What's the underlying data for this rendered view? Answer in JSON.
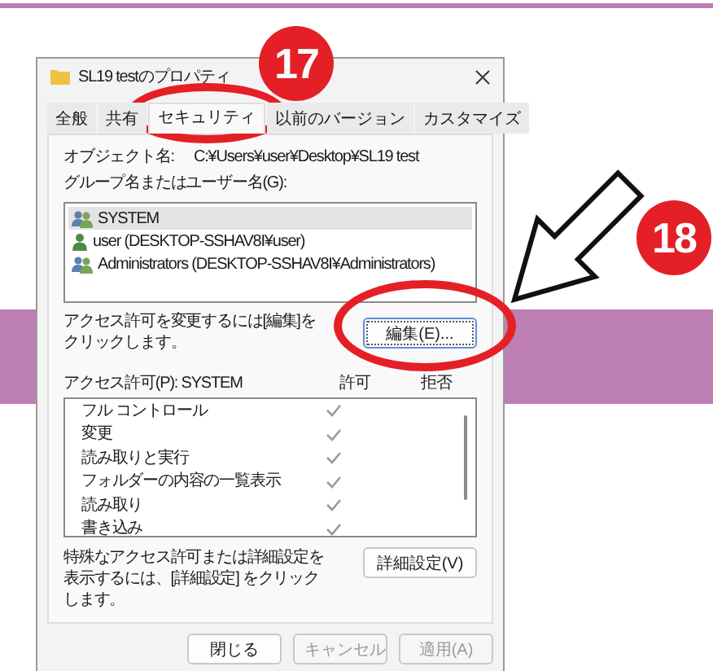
{
  "window": {
    "title": "SL19 testのプロパティ"
  },
  "tabs": [
    {
      "label": "全般",
      "selected": false
    },
    {
      "label": "共有",
      "selected": false
    },
    {
      "label": "セキュリティ",
      "selected": true
    },
    {
      "label": "以前のバージョン",
      "selected": false
    },
    {
      "label": "カスタマイズ",
      "selected": false
    }
  ],
  "object_name": {
    "label": "オブジェクト名:",
    "value": "C:¥Users¥user¥Desktop¥SL19 test"
  },
  "group_label": "グループ名またはユーザー名(G):",
  "principals": [
    {
      "name": "SYSTEM",
      "kind": "group",
      "selected": true
    },
    {
      "name": "user (DESKTOP-SSHAV8I¥user)",
      "kind": "user",
      "selected": false
    },
    {
      "name": "Administrators (DESKTOP-SSHAV8I¥Administrators)",
      "kind": "group",
      "selected": false
    }
  ],
  "change_hint": "アクセス許可を変更するには[編集]をクリックします。",
  "edit_button": "編集(E)...",
  "permissions": {
    "label": "アクセス許可(P): SYSTEM",
    "columns": [
      "許可",
      "拒否"
    ],
    "rows": [
      {
        "name": "フル コントロール",
        "allow": true,
        "deny": false
      },
      {
        "name": "変更",
        "allow": true,
        "deny": false
      },
      {
        "name": "読み取りと実行",
        "allow": true,
        "deny": false
      },
      {
        "name": "フォルダーの内容の一覧表示",
        "allow": true,
        "deny": false
      },
      {
        "name": "読み取り",
        "allow": true,
        "deny": false
      },
      {
        "name": "書き込み",
        "allow": true,
        "deny": false
      }
    ]
  },
  "advanced_hint": "特殊なアクセス許可または詳細設定を表示するには、[詳細設定] をクリックします。",
  "advanced_button": "詳細設定(V)",
  "buttons": [
    {
      "label": "閉じる",
      "disabled": false
    },
    {
      "label": "キャンセル",
      "disabled": true
    },
    {
      "label": "適用(A)",
      "disabled": true
    }
  ],
  "annotations": [
    {
      "number": "17"
    },
    {
      "number": "18"
    }
  ]
}
